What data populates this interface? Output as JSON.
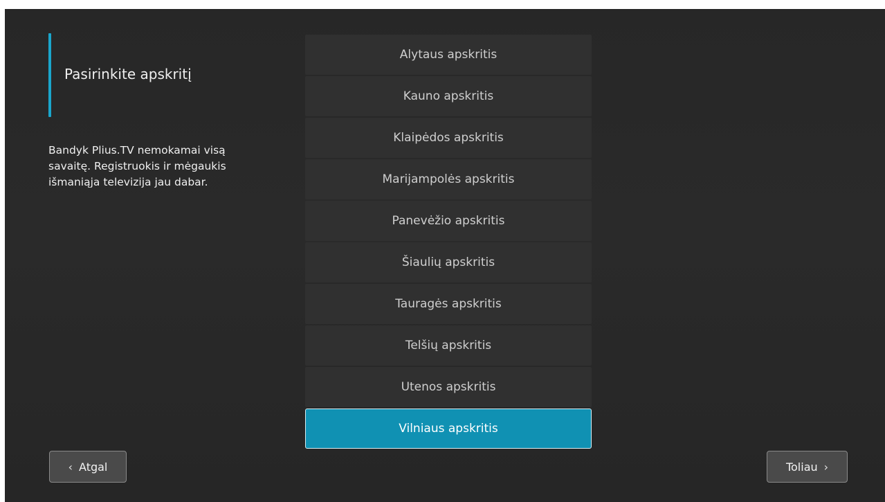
{
  "heading": {
    "title": "Pasirinkite apskritį"
  },
  "description": {
    "lines": [
      "Bandyk Plius.TV nemokamai visą",
      "savaitę. Registruokis ir mėgaukis",
      "išmaniąja televizija jau dabar."
    ]
  },
  "county_list": {
    "items": [
      {
        "label": "Alytaus apskritis",
        "selected": false
      },
      {
        "label": "Kauno apskritis",
        "selected": false
      },
      {
        "label": "Klaipėdos apskritis",
        "selected": false
      },
      {
        "label": "Marijampolės apskritis",
        "selected": false
      },
      {
        "label": "Panevėžio apskritis",
        "selected": false
      },
      {
        "label": "Šiaulių apskritis",
        "selected": false
      },
      {
        "label": "Tauragės apskritis",
        "selected": false
      },
      {
        "label": "Telšių apskritis",
        "selected": false
      },
      {
        "label": "Utenos apskritis",
        "selected": false
      },
      {
        "label": "Vilniaus apskritis",
        "selected": true
      }
    ]
  },
  "footer": {
    "back_label": "Atgal",
    "back_icon": "chevron-left-icon",
    "next_label": "Toliau",
    "next_icon": "chevron-right-icon"
  },
  "colors": {
    "accent": "#1aa6cc",
    "selected_item": "#1091b3",
    "background": "#282828",
    "item": "#303030"
  }
}
